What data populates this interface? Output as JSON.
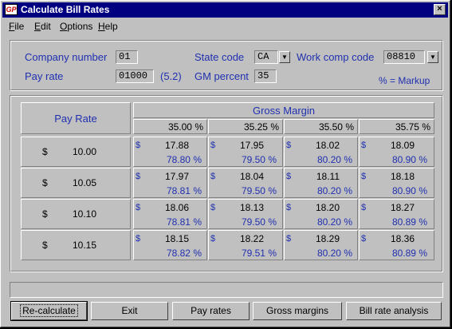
{
  "window": {
    "title": "Calculate Bill Rates",
    "icon_text": "GP",
    "close_label": "×"
  },
  "menu": [
    "File",
    "Edit",
    "Options",
    "Help"
  ],
  "form": {
    "company_number_label": "Company number",
    "company_number": "01",
    "pay_rate_label": "Pay rate",
    "pay_rate": "01000",
    "pay_rate_format": "(5.2)",
    "state_code_label": "State code",
    "state_code": "CA",
    "gm_percent_label": "GM percent",
    "gm_percent": "35",
    "work_comp_label": "Work comp code",
    "work_comp": "08810",
    "markup_note": "% = Markup"
  },
  "grid": {
    "pay_rate_header": "Pay Rate",
    "gross_margin_header": "Gross Margin",
    "currency": "$",
    "columns": [
      "35.00 %",
      "35.25 %",
      "35.50 %",
      "35.75 %"
    ],
    "rows": [
      {
        "pay_rate": "10.00",
        "cells": [
          {
            "amount": "17.88",
            "markup": "78.80 %"
          },
          {
            "amount": "17.95",
            "markup": "79.50 %"
          },
          {
            "amount": "18.02",
            "markup": "80.20 %"
          },
          {
            "amount": "18.09",
            "markup": "80.90 %"
          }
        ]
      },
      {
        "pay_rate": "10.05",
        "cells": [
          {
            "amount": "17.97",
            "markup": "78.81 %"
          },
          {
            "amount": "18.04",
            "markup": "79.50 %"
          },
          {
            "amount": "18.11",
            "markup": "80.20 %"
          },
          {
            "amount": "18.18",
            "markup": "80.90 %"
          }
        ]
      },
      {
        "pay_rate": "10.10",
        "cells": [
          {
            "amount": "18.06",
            "markup": "78.81 %"
          },
          {
            "amount": "18.13",
            "markup": "79.50 %"
          },
          {
            "amount": "18.20",
            "markup": "80.20 %"
          },
          {
            "amount": "18.27",
            "markup": "80.89 %"
          }
        ]
      },
      {
        "pay_rate": "10.15",
        "cells": [
          {
            "amount": "18.15",
            "markup": "78.82 %"
          },
          {
            "amount": "18.22",
            "markup": "79.51 %"
          },
          {
            "amount": "18.29",
            "markup": "80.20 %"
          },
          {
            "amount": "18.36",
            "markup": "80.89 %"
          }
        ]
      }
    ]
  },
  "buttons": {
    "recalculate": "Re-calculate",
    "exit": "Exit",
    "pay_rates": "Pay rates",
    "gross_margins": "Gross margins",
    "bill_rate_analysis": "Bill rate analysis"
  }
}
